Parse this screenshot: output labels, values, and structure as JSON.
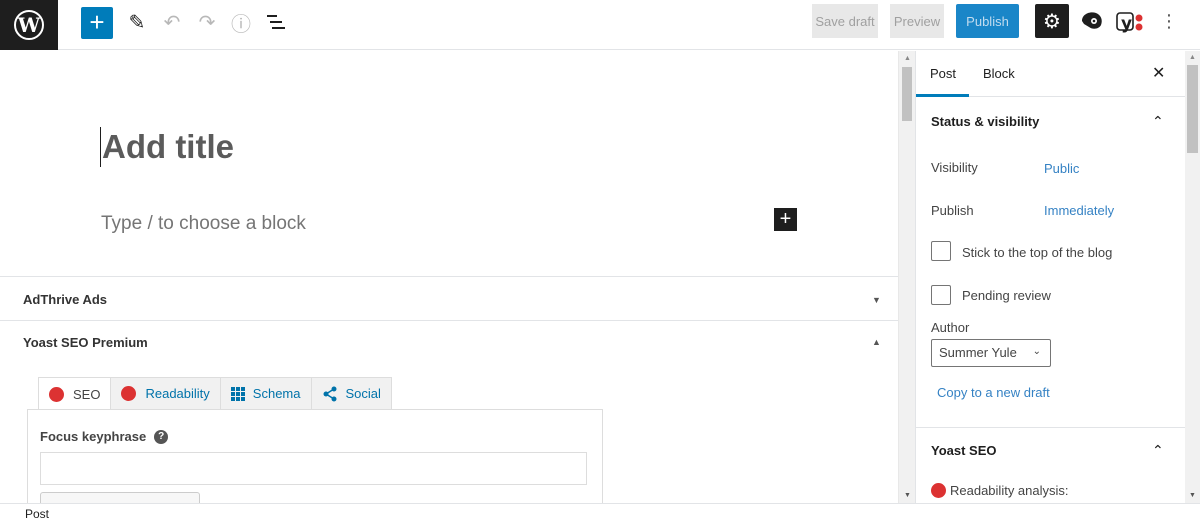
{
  "toolbar": {
    "logo": "W",
    "add_block_icon": "+",
    "tools_icon": "✎",
    "undo_icon": "↶",
    "redo_icon": "↷",
    "info_icon": "ⓘ",
    "outline_icon": "☰",
    "save_draft": "Save draft",
    "preview": "Preview",
    "publish": "Publish",
    "settings_icon": "⚙",
    "more_icon": "⋮"
  },
  "editor": {
    "title_placeholder": "Add title",
    "block_placeholder": "Type / to choose a block",
    "inline_add_icon": "+"
  },
  "metaboxes": [
    {
      "title": "AdThrive Ads",
      "toggle": "▼"
    },
    {
      "title": "Yoast SEO Premium",
      "toggle": "▲"
    }
  ],
  "yoast": {
    "tabs": [
      {
        "label": "SEO",
        "icon": "red-dot"
      },
      {
        "label": "Readability",
        "icon": "red-dot"
      },
      {
        "label": "Schema",
        "icon": "grid"
      },
      {
        "label": "Social",
        "icon": "share"
      }
    ],
    "focus_keyphrase_label": "Focus keyphrase",
    "help_icon": "?",
    "focus_keyphrase_value": "",
    "status_color": "#dc3232"
  },
  "sidebar": {
    "tabs": [
      "Post",
      "Block"
    ],
    "close_icon": "✕",
    "status_panel": {
      "title": "Status & visibility",
      "chevron": "⌃",
      "visibility_label": "Visibility",
      "visibility_value": "Public",
      "publish_label": "Publish",
      "publish_value": "Immediately",
      "sticky_label": "Stick to the top of the blog",
      "sticky_checked": false,
      "pending_label": "Pending review",
      "pending_checked": false,
      "author_label": "Author",
      "author_value": "Summer Yule",
      "copy_link": "Copy to a new draft"
    },
    "yoast_panel": {
      "title": "Yoast SEO",
      "chevron": "⌃",
      "readability_label": "Readability analysis:"
    }
  },
  "footer": {
    "breadcrumb": "Post"
  },
  "colors": {
    "accent": "#007cba",
    "link": "#3582c4",
    "error": "#dc3232",
    "dark": "#1e1e1e"
  }
}
